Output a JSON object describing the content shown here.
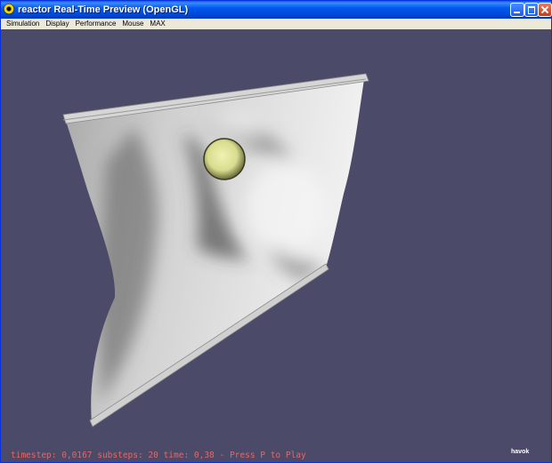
{
  "window": {
    "title": "reactor Real-Time Preview (OpenGL)"
  },
  "menubar": {
    "items": [
      "Simulation",
      "Display",
      "Performance",
      "Mouse",
      "MAX"
    ]
  },
  "viewport": {
    "background_color": "#4b4a68",
    "status_text": "timestep: 0,0167 substeps: 20 time: 0,38 - Press P to Play",
    "status_color": "#e46868",
    "logo_text": "havok"
  }
}
